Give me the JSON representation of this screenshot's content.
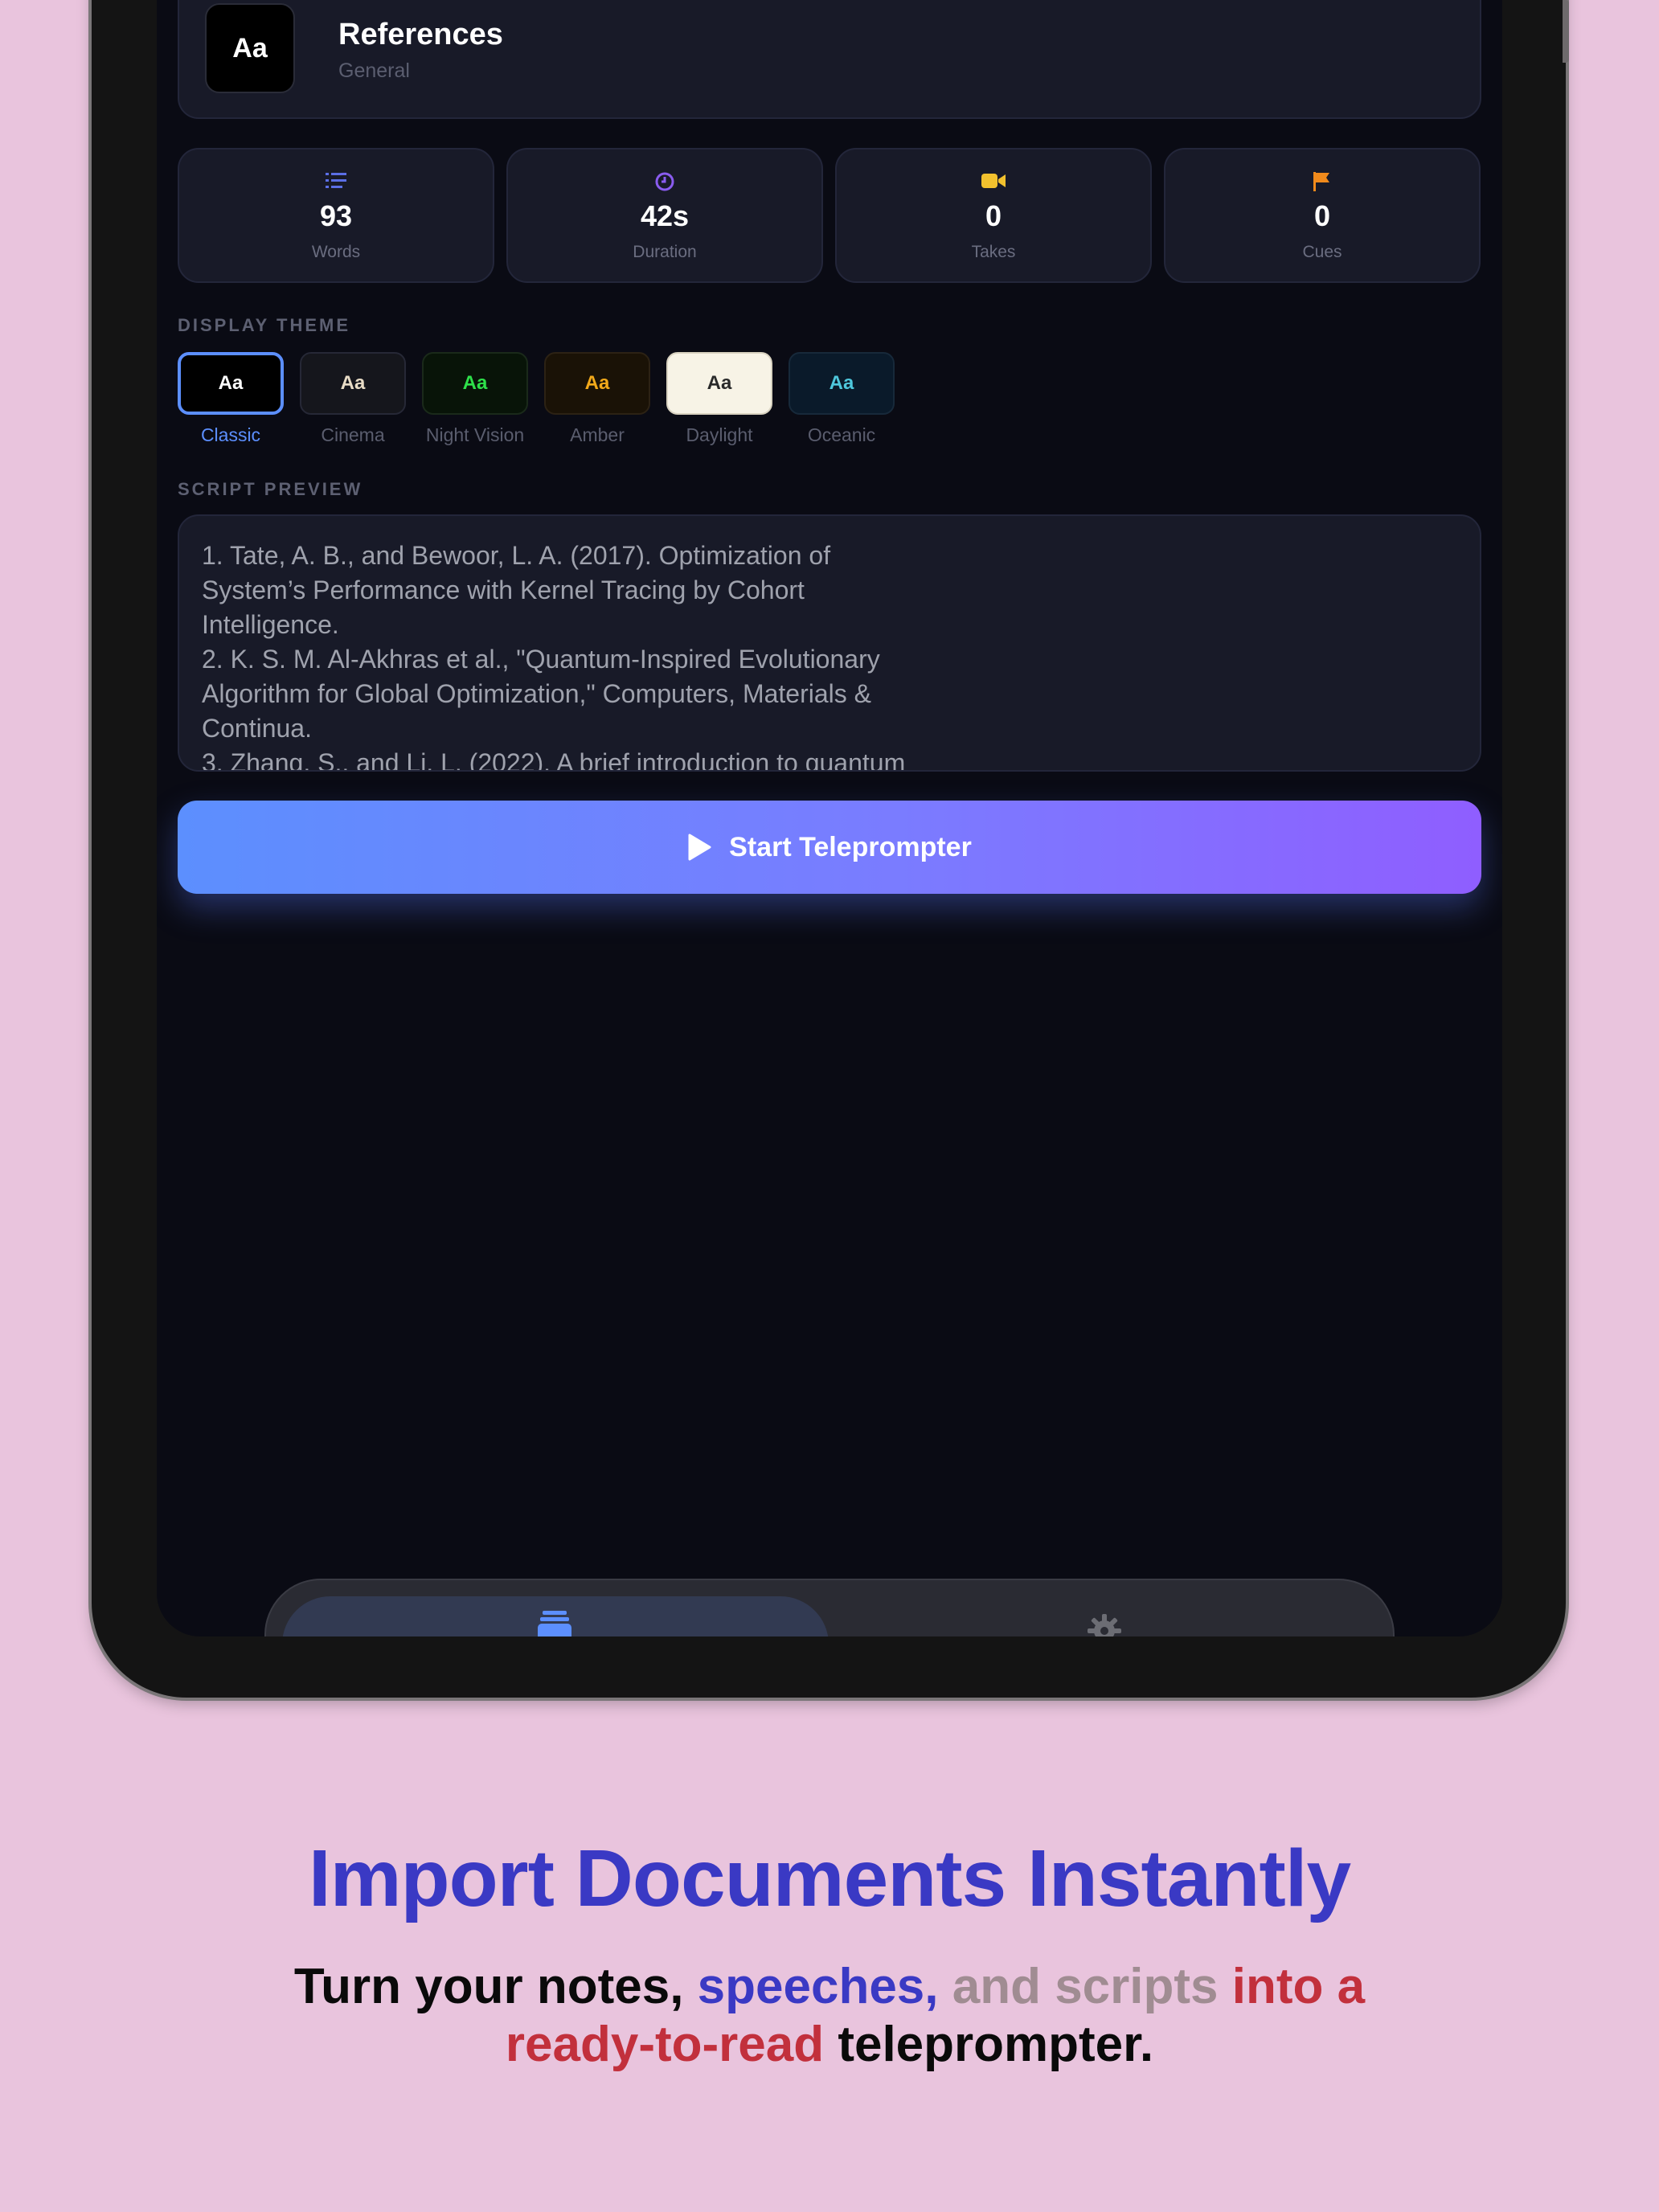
{
  "header": {
    "icon_text": "Aa",
    "title": "References",
    "subtitle": "General"
  },
  "stats": [
    {
      "icon": "list-icon",
      "value": "93",
      "label": "Words",
      "color": "#5b6fe6"
    },
    {
      "icon": "clock-icon",
      "value": "42s",
      "label": "Duration",
      "color": "#8a5cf0"
    },
    {
      "icon": "video-camera-icon",
      "value": "0",
      "label": "Takes",
      "color": "#f2c12e"
    },
    {
      "icon": "flag-icon",
      "value": "0",
      "label": "Cues",
      "color": "#f08a1c"
    }
  ],
  "display_theme": {
    "section_label": "DISPLAY THEME",
    "selected": "Classic",
    "themes": [
      {
        "name": "Classic",
        "sample": "Aa",
        "bg": "#000000",
        "fg": "#ffffff"
      },
      {
        "name": "Cinema",
        "sample": "Aa",
        "bg": "#15161c",
        "fg": "#e8dcc6"
      },
      {
        "name": "Night Vision",
        "sample": "Aa",
        "bg": "#081408",
        "fg": "#2ee04a"
      },
      {
        "name": "Amber",
        "sample": "Aa",
        "bg": "#1a1206",
        "fg": "#f2a91a"
      },
      {
        "name": "Daylight",
        "sample": "Aa",
        "bg": "#f7f3e6",
        "fg": "#2a2a2a"
      },
      {
        "name": "Oceanic",
        "sample": "Aa",
        "bg": "#0a1a2a",
        "fg": "#4ec7dc"
      }
    ]
  },
  "script_preview": {
    "section_label": "SCRIPT PREVIEW",
    "text": "1. Tate, A. B., and Bewoor, L. A. (2017). Optimization of System’s Performance with Kernel Tracing by Cohort Intelligence.\n2. K. S. M. Al-Akhras et al., \"Quantum-Inspired Evolutionary Algorithm for Global Optimization,\" Computers, Materials & Continua.\n3. Zhang, S., and Li, L. (2022). A brief introduction to quantum"
  },
  "start_button": {
    "label": "Start Teleprompter",
    "icon": "play-icon"
  },
  "tabbar": {
    "tabs": [
      {
        "icon": "library-icon",
        "active": true
      },
      {
        "icon": "gear-icon",
        "active": false
      }
    ]
  },
  "marketing": {
    "headline": "Import Documents Instantly",
    "subline": {
      "part1": "Turn your notes,",
      "part2": "speeches,",
      "part3": "and scripts",
      "part4": "into a ready-to-read",
      "part5": "teleprompter."
    }
  },
  "colors": {
    "background": "#e9c4dd",
    "screen": "#0a0b14",
    "accent": "#5c8ffe",
    "headline": "#3a39c4",
    "highlight_red": "#c2303c"
  }
}
